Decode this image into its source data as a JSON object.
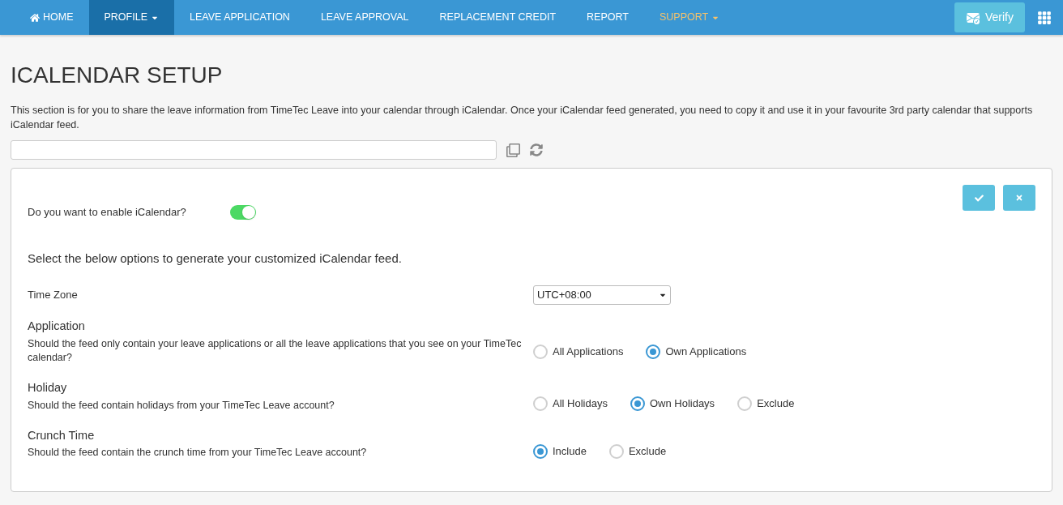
{
  "nav": {
    "items": [
      {
        "label": "HOME",
        "kind": "home",
        "selected": false
      },
      {
        "label": "PROFILE",
        "kind": "dropdown",
        "selected": true
      },
      {
        "label": "LEAVE APPLICATION",
        "kind": "plain",
        "selected": false
      },
      {
        "label": "LEAVE APPROVAL",
        "kind": "plain",
        "selected": false
      },
      {
        "label": "REPLACEMENT CREDIT",
        "kind": "plain",
        "selected": false
      },
      {
        "label": "REPORT",
        "kind": "plain",
        "selected": false
      },
      {
        "label": "SUPPORT",
        "kind": "highlight",
        "selected": false
      }
    ],
    "verify_button": "Verify"
  },
  "page": {
    "title": "ICALENDAR SETUP",
    "description": "This section is for you to share the leave information from TimeTec Leave into your calendar through iCalendar. Once your iCalendar feed generated, you need to copy it and use it in your favourite 3rd party calendar that supports iCalendar feed."
  },
  "settings": {
    "enable_label": "Do you want to enable iCalendar?",
    "enabled": true,
    "section_heading": "Select the below options to generate your customized iCalendar feed.",
    "time_zone": {
      "label": "Time Zone",
      "value": "UTC+08:00"
    },
    "options": [
      {
        "title": "Application",
        "question": "Should the feed only contain your leave applications or all the leave applications that you see on your TimeTec calendar?",
        "choices": [
          {
            "label": "All Applications",
            "selected": false
          },
          {
            "label": "Own Applications",
            "selected": true
          }
        ]
      },
      {
        "title": "Holiday",
        "question": "Should the feed contain holidays from your TimeTec Leave account?",
        "choices": [
          {
            "label": "All Holidays",
            "selected": false
          },
          {
            "label": "Own Holidays",
            "selected": true
          },
          {
            "label": "Exclude",
            "selected": false
          }
        ]
      },
      {
        "title": "Crunch Time",
        "question": "Should the feed contain the crunch time from your TimeTec Leave account?",
        "choices": [
          {
            "label": "Include",
            "selected": true
          },
          {
            "label": "Exclude",
            "selected": false
          }
        ]
      }
    ]
  }
}
